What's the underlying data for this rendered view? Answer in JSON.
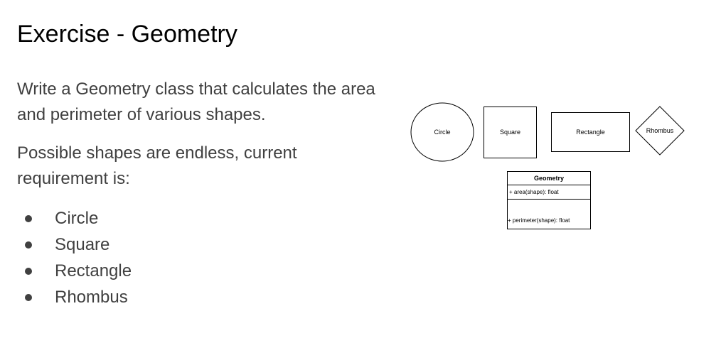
{
  "slide": {
    "title": "Exercise - Geometry",
    "intro": "Write a Geometry class that calculates the area and perimeter of various shapes.",
    "requirement": "Possible shapes are endless, current requirement is:",
    "shapes": [
      "Circle",
      "Square",
      "Rectangle",
      "Rhombus"
    ]
  },
  "diagram": {
    "shapes": {
      "circle": "Circle",
      "square": "Square",
      "rectangle": "Rectangle",
      "rhombus": "Rhombus"
    },
    "class_box": {
      "name": "Geometry",
      "method_area": "+ area(shape): float",
      "method_perimeter": "+ perimeter(shape): float"
    }
  }
}
